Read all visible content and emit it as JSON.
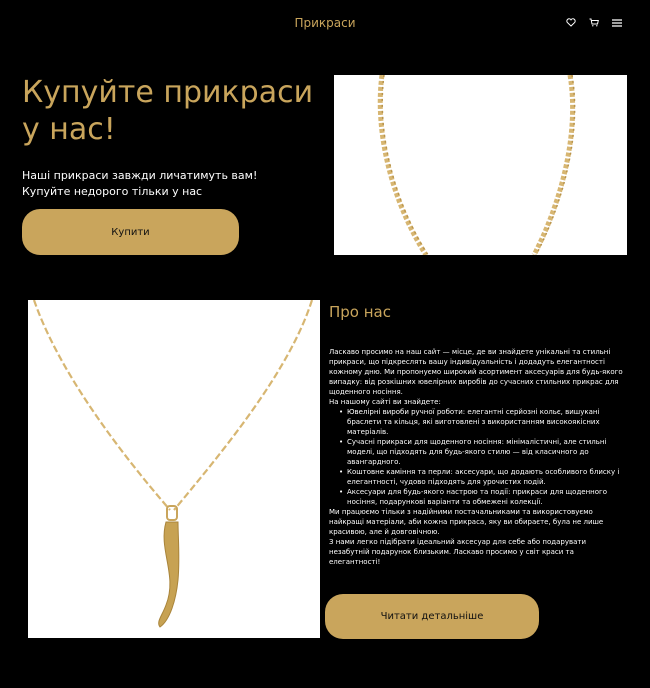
{
  "header": {
    "title": "Прикраси",
    "icons": [
      "heart-icon",
      "cart-icon",
      "menu-icon"
    ]
  },
  "hero": {
    "title": "Купуйте прикраси у нас!",
    "line1": "Наші прикраси завжди личатимуть вам!",
    "line2": "Купуйте недорого тільки у нас",
    "buy_label": "Купити"
  },
  "about": {
    "title": "Про нас",
    "intro": "Ласкаво просимо на наш сайт — місце, де ви знайдете унікальні та стильні прикраси, що підкреслять вашу індивідуальність і додадуть елегантності кожному дню. Ми пропонуємо широкий асортимент аксесуарів для будь-якого випадку: від розкішних ювелірних виробів до сучасних стильних прикрас для щоденного носіння.",
    "list_heading": "На нашому сайті ви знайдете:",
    "items": [
      "Ювелірні вироби ручної роботи: елегантні серйозні кольє, вишукані браслети та кільця, які виготовлені з використанням високоякісних матеріалів.",
      "Сучасні прикраси для щоденного носіння: мінімалістичні, але стильні моделі, що підходять для будь-якого стилю — від класичного до авангардного.",
      "Коштовне каміння та перли: аксесуари, що додають особливого блиску і елегантності, чудово підходять для урочистих подій.",
      "Аксесуари для будь-якого настрою та події: прикраси для щоденного носіння, подарункові варіанти та обмежені колекції."
    ],
    "para2": "Ми працюємо тільки з надійними постачальниками та використовуємо найкращі матеріали, аби кожна прикраса, яку ви обираєте, була не лише красивою, але й довговічною.",
    "para3": "З нами легко підібрати ідеальний аксесуар для себе або подарувати незабутній подарунок близьким. Ласкаво просимо у світ краси та елегантності!",
    "more_label": "Читати детальніше"
  },
  "colors": {
    "accent": "#c9a55c",
    "background": "#000000",
    "chain": "#d7b672"
  }
}
